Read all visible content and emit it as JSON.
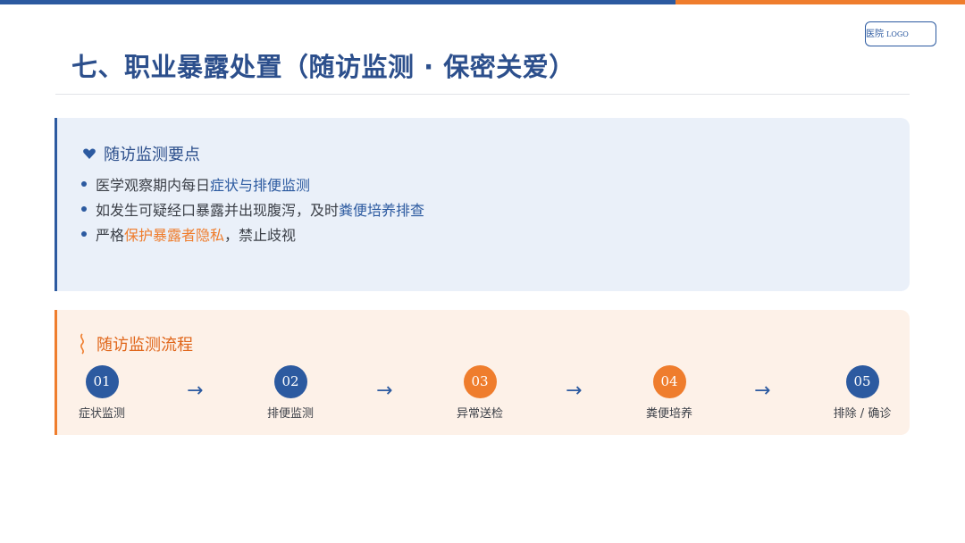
{
  "header": {
    "title": "七、职业暴露处置（随访监测 · 保密关爱）",
    "logo_cn": "医院",
    "logo_en": "LOGO"
  },
  "key_points": {
    "heading": "随访监测要点",
    "items": [
      {
        "pre": "医学观察期内每日",
        "hl": "症状与排便监测",
        "post": ""
      },
      {
        "pre": "如发生可疑经口暴露并出现腹泻，及时",
        "hl": "粪便培养排查",
        "post": ""
      },
      {
        "pre": "严格",
        "hl": "保护暴露者隐私",
        "post": "，禁止歧视"
      }
    ]
  },
  "process": {
    "heading": "随访监测流程",
    "steps": [
      {
        "num": "01",
        "label": "症状监测"
      },
      {
        "num": "02",
        "label": "排便监测"
      },
      {
        "num": "03",
        "label": "异常送检"
      },
      {
        "num": "04",
        "label": "粪便培养"
      },
      {
        "num": "05",
        "label": "排除 / 确诊"
      }
    ],
    "arrow_glyph": "→"
  },
  "colors": {
    "primary_blue": "#2c5aa0",
    "accent_orange": "#ef7d2d",
    "blue_panel_bg": "#eaf0f9",
    "orange_panel_bg": "#fdf1e8"
  },
  "icons": {
    "key_points_icon": "heart-icon",
    "process_icon": "wave-icon"
  }
}
